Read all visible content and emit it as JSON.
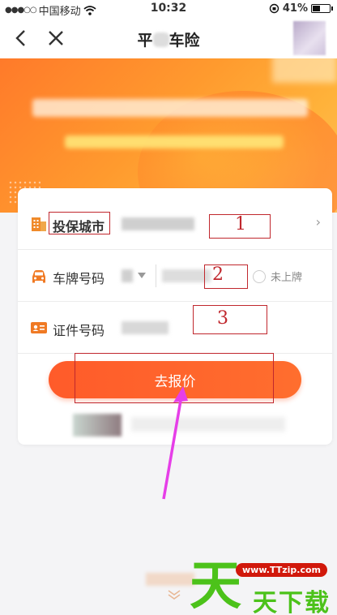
{
  "status_bar": {
    "carrier": "中国移动",
    "time": "10:32",
    "battery": "41%"
  },
  "nav": {
    "title_left": "平",
    "title_right": "车险"
  },
  "form": {
    "city_label": "投保城市",
    "plate_label": "车牌号码",
    "plate_unregistered": "未上牌",
    "id_label": "证件号码",
    "submit_label": "去报价"
  },
  "annotations": [
    "1",
    "2",
    "3"
  ],
  "watermark": {
    "url": "www.TTzip.com",
    "big": "天",
    "text": "天下载"
  },
  "colors": {
    "accent": "#ff5b2a",
    "annotation": "#c0272d",
    "arrow": "#e63ee8",
    "watermark": "#4cc21a"
  }
}
